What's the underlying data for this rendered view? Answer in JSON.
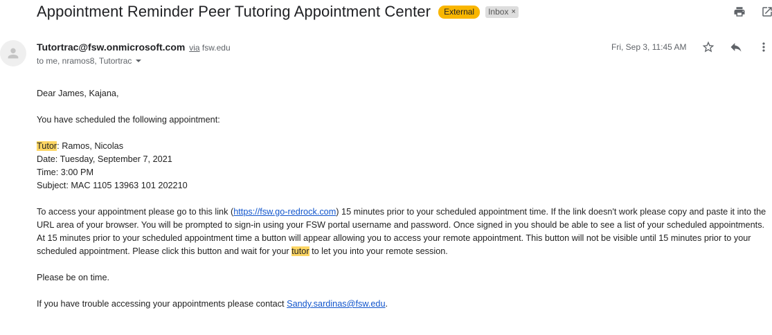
{
  "subject": "Appointment Reminder Peer Tutoring Appointment Center",
  "labels": {
    "external": "External",
    "inbox": "Inbox",
    "inbox_remove": "×"
  },
  "sender": {
    "email": "Tutortrac@fsw.onmicrosoft.com",
    "via_word": "via",
    "via_domain": "fsw.edu",
    "recipients": "to me, nramos8, Tutortrac"
  },
  "date": "Fri, Sep 3, 11:45 AM",
  "icons": [
    "print-icon",
    "open-in-new-window-icon",
    "avatar-person-icon",
    "star-icon",
    "reply-icon",
    "more-vert-icon",
    "chevron-down-icon"
  ],
  "colors": {
    "external_label": "#f9b600",
    "inbox_label": "#dddddd",
    "highlight": "#fdd663",
    "link": "#1155cc"
  },
  "body": {
    "greeting": "Dear James, Kajana,",
    "intro": "You have scheduled the following appointment:",
    "tutor_label": "Tutor",
    "tutor_value": ": Ramos, Nicolas",
    "date_line": "Date: Tuesday, September 7, 2021",
    "time_line": "Time: 3:00 PM",
    "subject_line": "Subject: MAC 1105 13963 101 202210",
    "para1_a": "To access your appointment please go to this link (",
    "para1_link": "https://fsw.go-redrock.com",
    "para1_b": ") 15 minutes prior to your scheduled appointment time. If the link doesn't work please copy and paste it into the URL area of your browser. You will be prompted to sign-in using your FSW portal username and password. Once signed in you should be able to see a list of your scheduled appointments. At 15 minutes prior to your scheduled appointment time a button will appear allowing you to access your remote appointment. This button will not be visible until 15 minutes prior to your scheduled appointment. Please click this button and wait for your ",
    "para1_tutor": "tutor",
    "para1_c": " to let you into your remote session.",
    "on_time": "Please be on time.",
    "contact_a": "If you have trouble accessing your appointments please contact ",
    "contact_link": "Sandy.sardinas@fsw.edu",
    "contact_b": "."
  }
}
